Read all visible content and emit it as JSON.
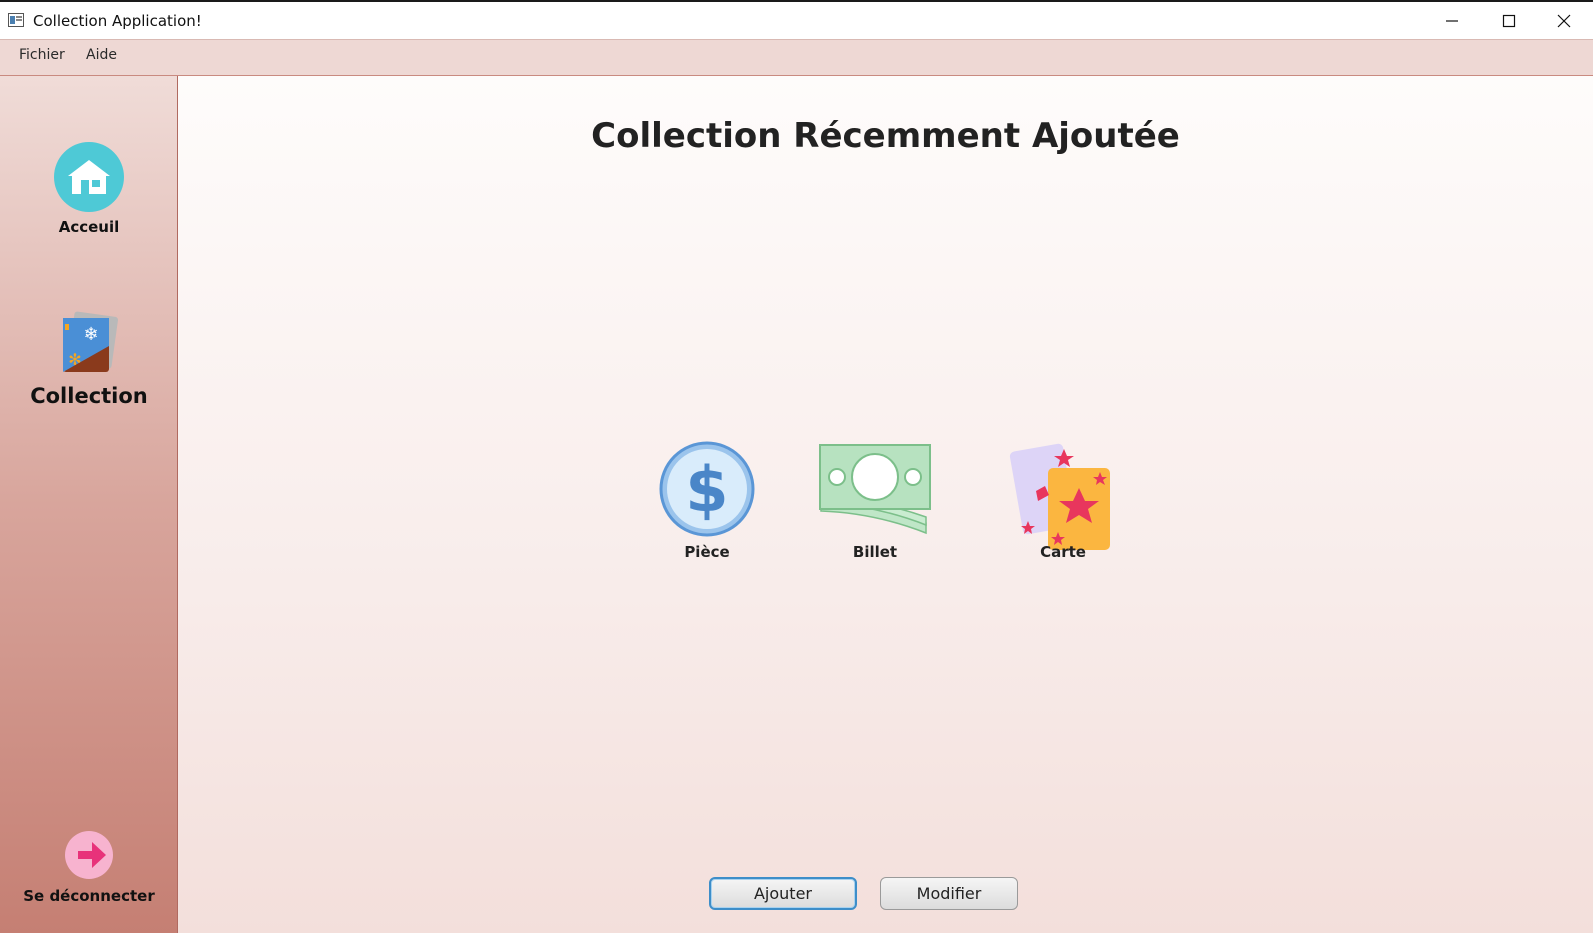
{
  "window": {
    "title": "Collection Application!"
  },
  "menu": {
    "items": [
      {
        "label": "Fichier"
      },
      {
        "label": "Aide"
      }
    ]
  },
  "sidebar": {
    "home_label": "Acceuil",
    "collection_label": "Collection",
    "logout_label": "Se déconnecter"
  },
  "main": {
    "title": "Collection Récemment Ajoutée",
    "categories": [
      {
        "label": "Pièce",
        "icon": "coin-icon"
      },
      {
        "label": "Billet",
        "icon": "banknote-icon"
      },
      {
        "label": "Carte",
        "icon": "card-icon"
      }
    ],
    "buttons": {
      "add_label": "Ajouter",
      "edit_label": "Modifier"
    }
  },
  "colors": {
    "accent_blue": "#3d8ec9",
    "home_icon_bg": "#4ec9d6",
    "logout_icon_bg": "#f7b3cf"
  }
}
